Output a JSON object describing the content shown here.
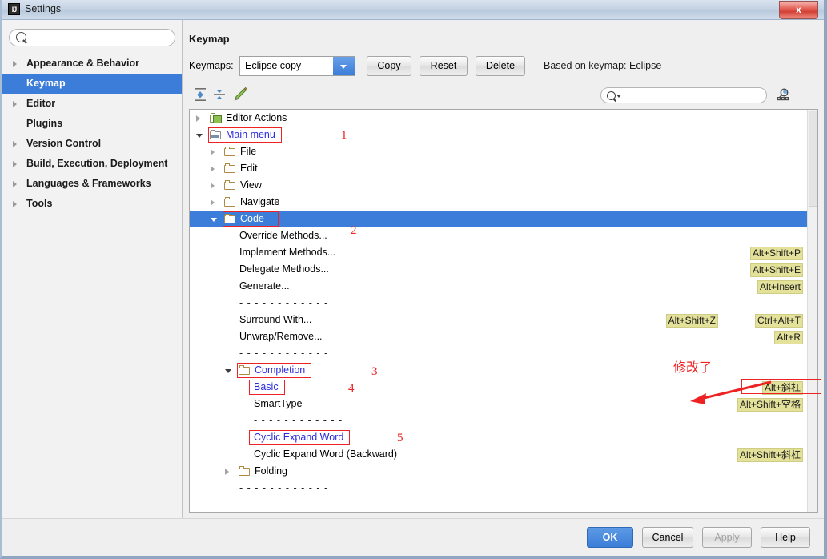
{
  "window": {
    "title": "Settings",
    "app_icon": "IJ",
    "close_label": "x"
  },
  "sidebar": {
    "search_placeholder": "",
    "search_value": "",
    "items": [
      {
        "label": "Appearance & Behavior",
        "expandable": true,
        "selected": false
      },
      {
        "label": "Keymap",
        "expandable": false,
        "selected": true
      },
      {
        "label": "Editor",
        "expandable": true,
        "selected": false
      },
      {
        "label": "Plugins",
        "expandable": false,
        "selected": false
      },
      {
        "label": "Version Control",
        "expandable": true,
        "selected": false
      },
      {
        "label": "Build, Execution, Deployment",
        "expandable": true,
        "selected": false
      },
      {
        "label": "Languages & Frameworks",
        "expandable": true,
        "selected": false
      },
      {
        "label": "Tools",
        "expandable": true,
        "selected": false
      }
    ]
  },
  "main": {
    "page_title": "Keymap",
    "keymaps_label": "Keymaps:",
    "keymap_selected": "Eclipse copy",
    "buttons": {
      "copy": "Copy",
      "reset": "Reset",
      "delete": "Delete"
    },
    "based_on": "Based on keymap: Eclipse",
    "toolbar": {
      "expand_all": "expand-all",
      "collapse_all": "collapse-all",
      "edit_shortcut": "edit-shortcut",
      "search_value": "",
      "filter": "filter-by-shortcut"
    }
  },
  "tree": [
    {
      "label": "Editor Actions",
      "indent": 0,
      "twisty": "closed",
      "icon": "folder-green",
      "shortcut": "",
      "highlight": false,
      "blue": false
    },
    {
      "label": "Main menu",
      "indent": 0,
      "twisty": "open",
      "icon": "folder-keyboard",
      "shortcut": "",
      "highlight": true,
      "blue": true
    },
    {
      "label": "File",
      "indent": 1,
      "twisty": "closed",
      "icon": "folder",
      "shortcut": "",
      "highlight": false,
      "blue": false
    },
    {
      "label": "Edit",
      "indent": 1,
      "twisty": "closed",
      "icon": "folder",
      "shortcut": "",
      "highlight": false,
      "blue": false
    },
    {
      "label": "View",
      "indent": 1,
      "twisty": "closed",
      "icon": "folder",
      "shortcut": "",
      "highlight": false,
      "blue": false
    },
    {
      "label": "Navigate",
      "indent": 1,
      "twisty": "closed",
      "icon": "folder",
      "shortcut": "",
      "highlight": false,
      "blue": false
    },
    {
      "label": "Code",
      "indent": 1,
      "twisty": "open",
      "icon": "folder",
      "shortcut": "",
      "highlight": true,
      "blue": false,
      "selected": true
    },
    {
      "label": "Override Methods...",
      "indent": 2,
      "twisty": "none",
      "icon": "none",
      "shortcut": "",
      "highlight": false,
      "blue": false
    },
    {
      "label": "Implement Methods...",
      "indent": 2,
      "twisty": "none",
      "icon": "none",
      "shortcut": "Alt+Shift+P",
      "highlight": false,
      "blue": false
    },
    {
      "label": "Delegate Methods...",
      "indent": 2,
      "twisty": "none",
      "icon": "none",
      "shortcut": "Alt+Shift+E",
      "highlight": false,
      "blue": false
    },
    {
      "label": "Generate...",
      "indent": 2,
      "twisty": "none",
      "icon": "none",
      "shortcut": "Alt+Insert",
      "highlight": false,
      "blue": false
    },
    {
      "label": "- - - - - - - - - - - -",
      "indent": 2,
      "twisty": "none",
      "icon": "none",
      "shortcut": "",
      "separator": true,
      "highlight": false,
      "blue": false
    },
    {
      "label": "Surround With...",
      "indent": 2,
      "twisty": "none",
      "icon": "none",
      "shortcut": "Ctrl+Alt+T",
      "shortcut2": "Alt+Shift+Z",
      "highlight": false,
      "blue": false
    },
    {
      "label": "Unwrap/Remove...",
      "indent": 2,
      "twisty": "none",
      "icon": "none",
      "shortcut": "Alt+R",
      "highlight": false,
      "blue": false
    },
    {
      "label": "- - - - - - - - - - - -",
      "indent": 2,
      "twisty": "none",
      "icon": "none",
      "shortcut": "",
      "separator": true,
      "highlight": false,
      "blue": false
    },
    {
      "label": "Completion",
      "indent": 2,
      "twisty": "open",
      "icon": "folder",
      "shortcut": "",
      "highlight": true,
      "blue": true
    },
    {
      "label": "Basic",
      "indent": 3,
      "twisty": "none",
      "icon": "none",
      "shortcut": "Alt+斜杠",
      "highlight": true,
      "blue": true
    },
    {
      "label": "SmartType",
      "indent": 3,
      "twisty": "none",
      "icon": "none",
      "shortcut": "Alt+Shift+空格",
      "highlight": false,
      "blue": false
    },
    {
      "label": "- - - - - - - - - - - -",
      "indent": 3,
      "twisty": "none",
      "icon": "none",
      "shortcut": "",
      "separator": true,
      "highlight": false,
      "blue": false
    },
    {
      "label": "Cyclic Expand Word",
      "indent": 3,
      "twisty": "none",
      "icon": "none",
      "shortcut": "",
      "highlight": true,
      "blue": true
    },
    {
      "label": "Cyclic Expand Word (Backward)",
      "indent": 3,
      "twisty": "none",
      "icon": "none",
      "shortcut": "Alt+Shift+斜杠",
      "highlight": false,
      "blue": false
    },
    {
      "label": "Folding",
      "indent": 2,
      "twisty": "closed",
      "icon": "folder",
      "shortcut": "",
      "highlight": false,
      "blue": false
    },
    {
      "label": "- - - - - - - - - - - -",
      "indent": 2,
      "twisty": "none",
      "icon": "none",
      "shortcut": "",
      "separator": true,
      "highlight": false,
      "blue": false
    }
  ],
  "annotations": {
    "n1": "1",
    "n2": "2",
    "n3": "3",
    "n4": "4",
    "n5": "5",
    "chinese_note": "修改了",
    "color": "#ee2222"
  },
  "footer": {
    "ok": "OK",
    "cancel": "Cancel",
    "apply": "Apply",
    "help": "Help"
  }
}
